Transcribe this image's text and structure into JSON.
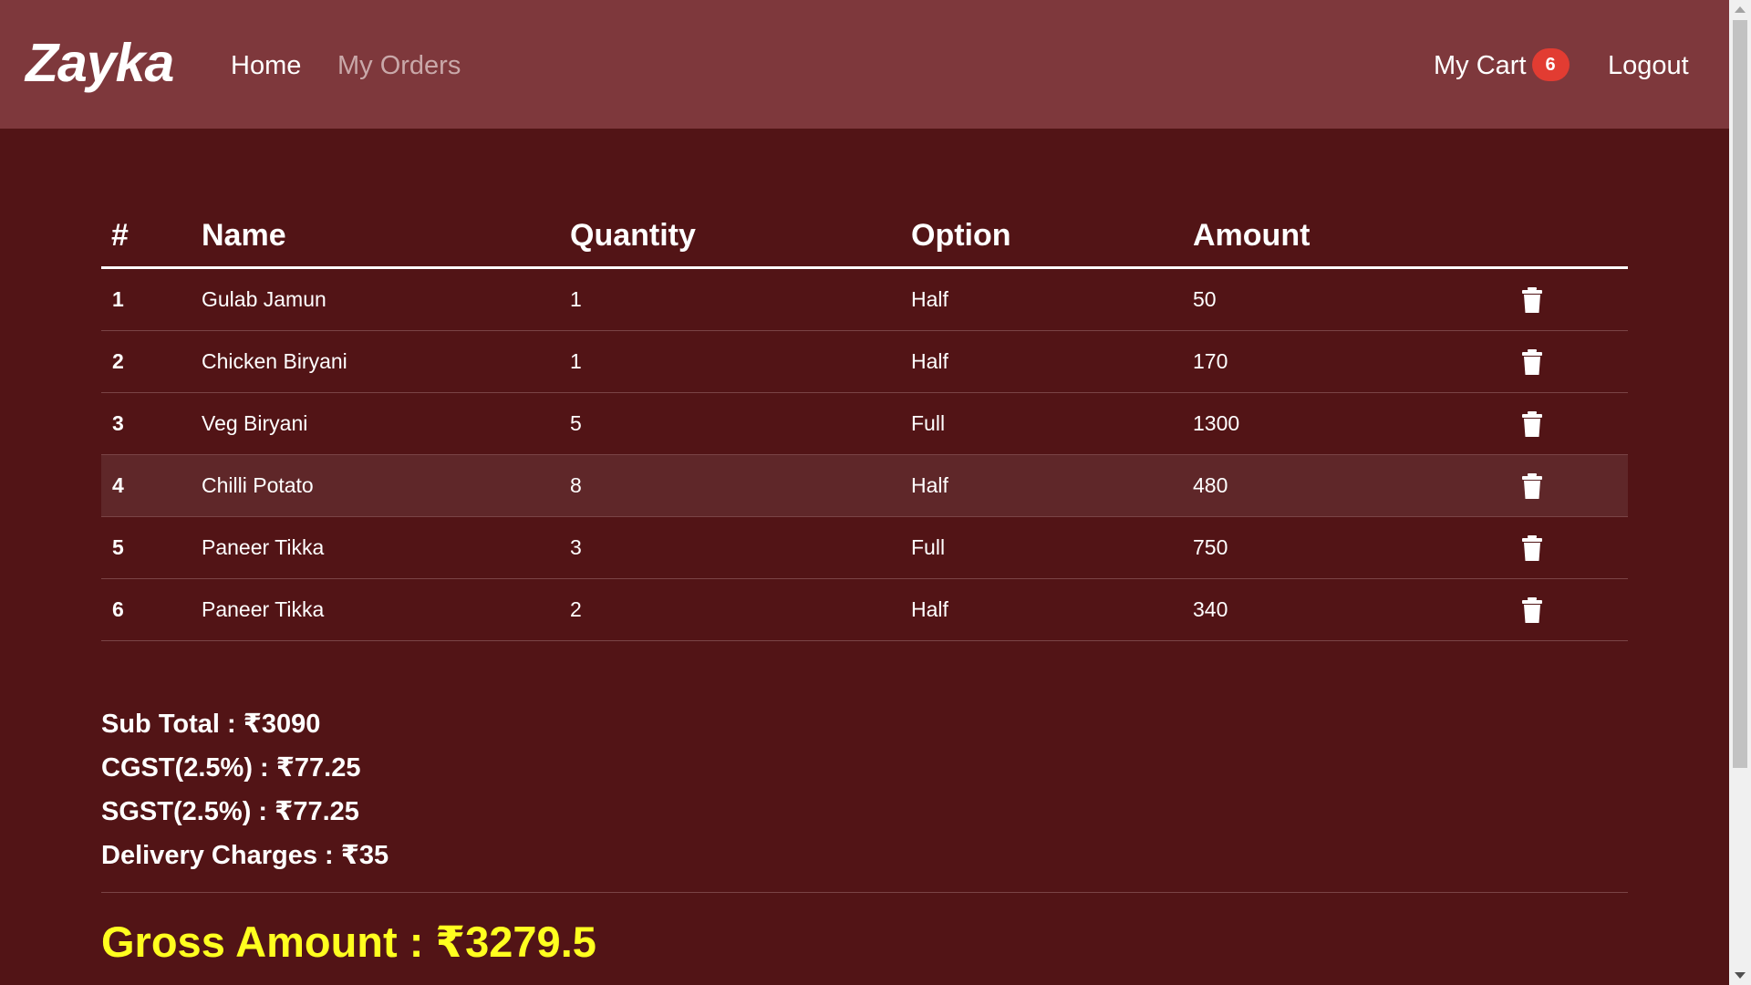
{
  "navbar": {
    "brand": "Zayka",
    "links": {
      "home": "Home",
      "my_orders": "My Orders",
      "my_cart": "My Cart",
      "logout": "Logout"
    },
    "cart_count": "6"
  },
  "table": {
    "headers": [
      "#",
      "Name",
      "Quantity",
      "Option",
      "Amount"
    ],
    "rows": [
      {
        "num": "1",
        "name": "Gulab Jamun",
        "quantity": "1",
        "option": "Half",
        "amount": "50"
      },
      {
        "num": "2",
        "name": "Chicken Biryani",
        "quantity": "1",
        "option": "Half",
        "amount": "170"
      },
      {
        "num": "3",
        "name": "Veg Biryani",
        "quantity": "5",
        "option": "Full",
        "amount": "1300"
      },
      {
        "num": "4",
        "name": "Chilli Potato",
        "quantity": "8",
        "option": "Half",
        "amount": "480"
      },
      {
        "num": "5",
        "name": "Paneer Tikka",
        "quantity": "3",
        "option": "Full",
        "amount": "750"
      },
      {
        "num": "6",
        "name": "Paneer Tikka",
        "quantity": "2",
        "option": "Half",
        "amount": "340"
      }
    ],
    "row_action_icon": "trash-icon"
  },
  "summary": {
    "sub_total": "Sub Total : ₹3090",
    "cgst": "CGST(2.5%) : ₹77.25",
    "sgst": "SGST(2.5%) : ₹77.25",
    "delivery": "Delivery Charges : ₹35",
    "gross": "Gross Amount : ₹3279.5"
  },
  "colors": {
    "background": "#521416",
    "navbar": "#7e383c",
    "badge": "#e23c32",
    "gross_text": "#ffff1f",
    "highlight_row": "#5f2729"
  }
}
